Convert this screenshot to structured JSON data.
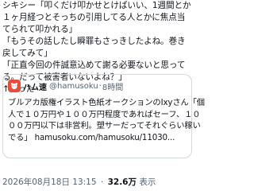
{
  "post": {
    "lines": [
      "シキシー「叩くだけ叩かせとけばいい、1週間とか",
      "１ヶ月経つとそっちの引用してる人とかに焦点当",
      "てられて叩かれる」",
      "「もうその話したし瞬罪もさっきしたよね。巻き",
      "戻してみて」",
      "「正直今回の件誠意込めて謝る必要ないと思って",
      "る。だって被害者いないよね？」",
      "↑言った"
    ]
  },
  "quote": {
    "name": "ハム速",
    "handle": "@hamusoku",
    "separator": "·",
    "time": "8時間",
    "lines": [
      "ブルアカ版権イラスト色紙オークションのIxyさん「個",
      "人で１０万円や１００万円程度であればセーフ、１０",
      "００万円以下は非営利。塑サーだってそれぐらい稼い",
      "でる」 hamusoku.com/hamusoku/11030..."
    ]
  },
  "meta": {
    "timestamp": "2026年08月18日 13:15",
    "separator": "·",
    "views_count": "32.6万",
    "views_label": "表示"
  },
  "colors": {
    "text": "#0f1419",
    "secondary": "#536471",
    "border": "#cfd9de",
    "avatar": "#e74c3c"
  }
}
